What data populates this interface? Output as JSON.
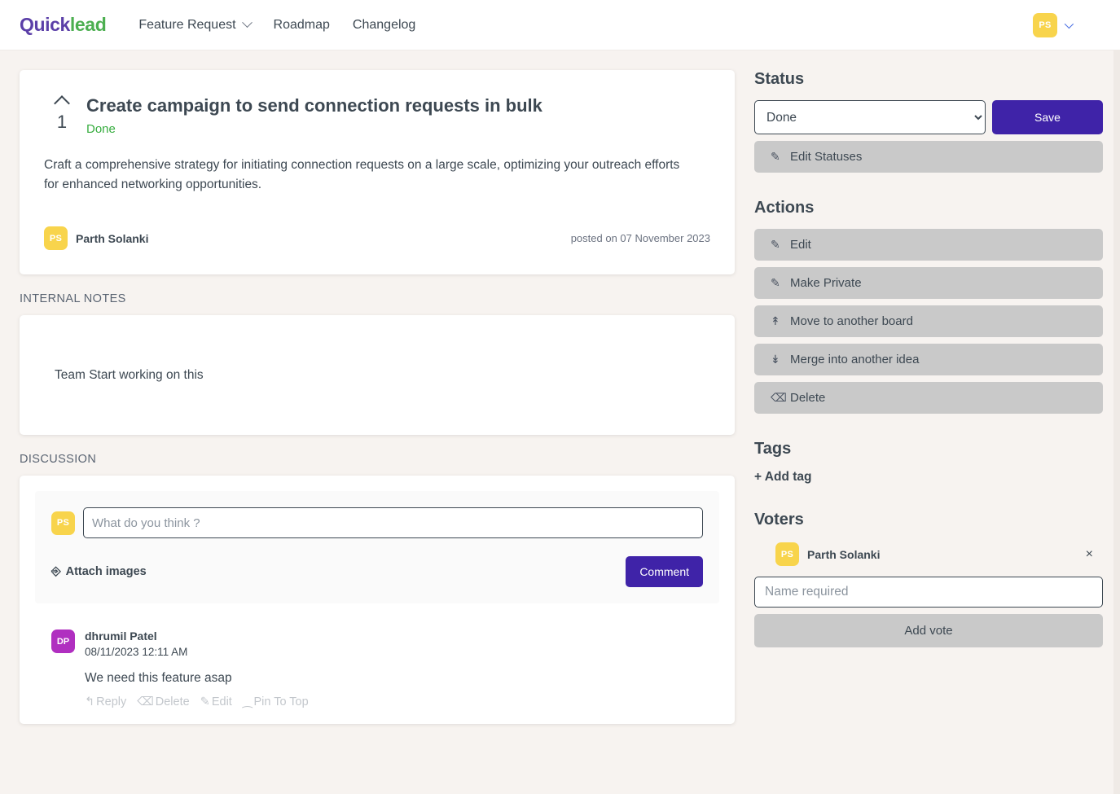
{
  "header": {
    "logo_quick": "Quick",
    "logo_lead": "lead",
    "nav": [
      {
        "label": "Feature Request",
        "has_dropdown": true
      },
      {
        "label": "Roadmap",
        "has_dropdown": false
      },
      {
        "label": "Changelog",
        "has_dropdown": false
      }
    ],
    "user_initials": "PS"
  },
  "idea": {
    "vote_count": "1",
    "title": "Create campaign to send connection requests in bulk",
    "status": "Done",
    "description": "Craft a comprehensive strategy for initiating connection requests on a large scale, optimizing your outreach efforts for enhanced networking opportunities.",
    "author_initials": "PS",
    "author_name": "Parth Solanki",
    "posted": "posted on 07 November 2023"
  },
  "internal_notes": {
    "heading": "INTERNAL NOTES",
    "text": "Team Start working on this"
  },
  "discussion": {
    "heading": "DISCUSSION",
    "composer": {
      "avatar_initials": "PS",
      "placeholder": "What do you think ?",
      "value": "",
      "attach_label": "Attach images",
      "submit_label": "Comment"
    },
    "comments": [
      {
        "avatar_initials": "DP",
        "author": "dhrumil Patel",
        "timestamp": "08/11/2023 12:11 AM",
        "body": "We need this feature asap",
        "actions": [
          {
            "icon": "reply-icon",
            "glyph": "↰",
            "label": "Reply"
          },
          {
            "icon": "trash-icon",
            "glyph": "Ὕ1",
            "label": "Delete"
          },
          {
            "icon": "pencil-icon",
            "glyph": "✐",
            "label": "Edit"
          },
          {
            "icon": "pin-icon",
            "glyph": "⁐",
            "label": "Pin To Top"
          }
        ]
      }
    ]
  },
  "sidebar": {
    "status": {
      "heading": "Status",
      "selected": "Done",
      "options": [
        "Done"
      ],
      "save_label": "Save",
      "edit_statuses_label": "Edit Statuses"
    },
    "actions": {
      "heading": "Actions",
      "items": [
        {
          "icon": "pencil-icon",
          "glyph": "✐",
          "label": "Edit"
        },
        {
          "icon": "pencil-icon",
          "glyph": "✐",
          "label": "Make Private"
        },
        {
          "icon": "upload-icon",
          "glyph": "⇧",
          "label": "Move to another board"
        },
        {
          "icon": "download-icon",
          "glyph": "⇩",
          "label": "Merge into another idea"
        },
        {
          "icon": "trash-icon",
          "glyph": "Ὕ1",
          "label": "Delete"
        }
      ]
    },
    "tags": {
      "heading": "Tags",
      "add_label": "+ Add tag"
    },
    "voters": {
      "heading": "Voters",
      "list": [
        {
          "initials": "PS",
          "name": "Parth Solanki",
          "remove": "×"
        }
      ],
      "input_placeholder": "Name required",
      "input_value": "",
      "add_vote_label": "Add vote"
    }
  },
  "colors": {
    "brand_purple": "#5b3fa8",
    "brand_green": "#4caf50",
    "accent_button": "#3f23a8",
    "avatar_yellow": "#f8d44c",
    "avatar_purple": "#b02fc0",
    "status_done": "#37ad3f",
    "page_bg": "#f7f3f0",
    "gray_button": "#c9c9c9"
  }
}
